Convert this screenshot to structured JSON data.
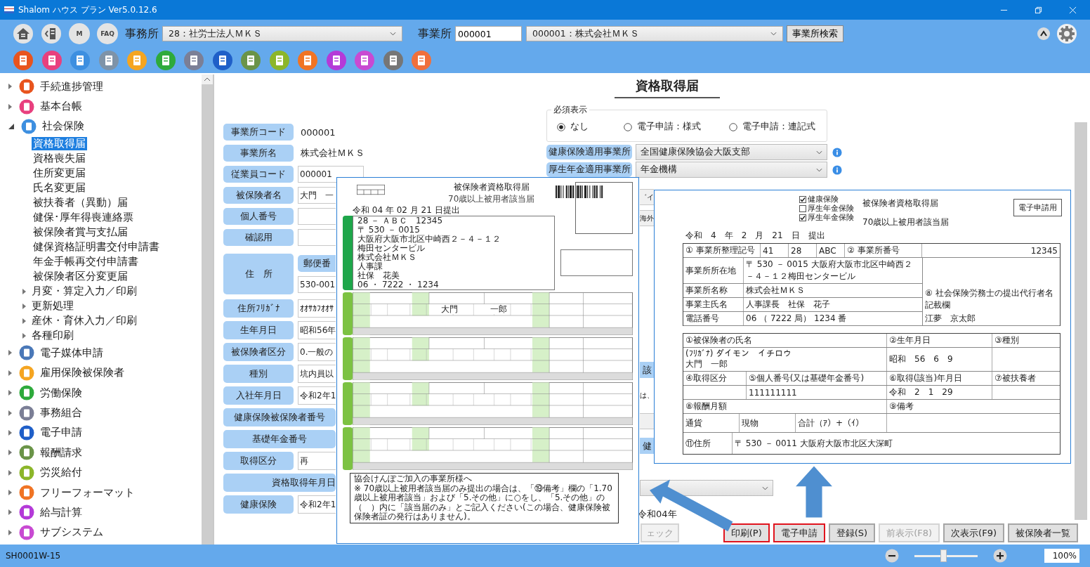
{
  "window": {
    "title": "Shalom ハウス プラン Ver5.0.12.6"
  },
  "toolbar": {
    "nav_buttons": [
      {
        "kind": "home"
      },
      {
        "kind": "back"
      },
      {
        "kind": "text",
        "text": "M"
      },
      {
        "kind": "text",
        "text": "FAQ"
      }
    ],
    "office_label": "事務所",
    "office_value": "28：社労士法人ＭＫＳ",
    "site_label": "事業所",
    "site_code": "000001",
    "site_value": "000001：株式会社ＭＫＳ",
    "search_button": "事業所検索",
    "app_icons": [
      {
        "color": "#e8541e"
      },
      {
        "color": "#e8407e"
      },
      {
        "color": "#3d8fe0"
      },
      {
        "color": "#7e93a8"
      },
      {
        "color": "#f5a521"
      },
      {
        "color": "#2eaa3c"
      },
      {
        "color": "#7b7f96"
      },
      {
        "color": "#1f5fc8"
      },
      {
        "color": "#6a9448"
      },
      {
        "color": "#8cb62a"
      },
      {
        "color": "#f07424"
      },
      {
        "color": "#b43ad8"
      },
      {
        "color": "#c84ad2"
      },
      {
        "color": "#767676"
      },
      {
        "color": "#f0703c"
      }
    ]
  },
  "sidebar": {
    "items": [
      {
        "label": "手続進捗管理",
        "color": "#e8541e",
        "expanded": false
      },
      {
        "label": "基本台帳",
        "color": "#e8407e",
        "expanded": false
      },
      {
        "label": "社会保険",
        "color": "#3d8fe0",
        "expanded": true,
        "children": [
          {
            "label": "資格取得届",
            "selected": true
          },
          {
            "label": "資格喪失届",
            "selected": false
          },
          {
            "label": "住所変更届",
            "selected": false
          },
          {
            "label": "氏名変更届",
            "selected": false
          },
          {
            "label": "被扶養者（異動）届",
            "selected": false
          },
          {
            "label": "健保･厚年得喪連絡票",
            "selected": false
          },
          {
            "label": "被保険者賞与支払届",
            "selected": false
          },
          {
            "label": "健保資格証明書交付申請書",
            "selected": false
          },
          {
            "label": "年金手帳再交付申請書",
            "selected": false
          },
          {
            "label": "被保険者区分変更届",
            "selected": false
          },
          {
            "label": "月変・算定入力／印刷",
            "expanded": false
          },
          {
            "label": "更新処理",
            "expanded": false
          },
          {
            "label": "産休・育休入力／印刷",
            "expanded": false
          },
          {
            "label": "各種印刷",
            "expanded": false
          }
        ]
      },
      {
        "label": "電子媒体申請",
        "color": "#4a78b8",
        "expanded": false
      },
      {
        "label": "雇用保険被保険者",
        "color": "#f5a521",
        "expanded": false
      },
      {
        "label": "労働保険",
        "color": "#2eaa3c",
        "expanded": false
      },
      {
        "label": "事務組合",
        "color": "#7b7f96",
        "expanded": false
      },
      {
        "label": "電子申請",
        "color": "#1f5fc8",
        "expanded": false
      },
      {
        "label": "報酬請求",
        "color": "#6a9448",
        "expanded": false
      },
      {
        "label": "労災給付",
        "color": "#8cb62a",
        "expanded": false
      },
      {
        "label": "フリーフォーマット",
        "color": "#f07424",
        "expanded": false
      },
      {
        "label": "給与計算",
        "color": "#b43ad8",
        "expanded": false
      },
      {
        "label": "サブシステム",
        "color": "#c84ad2",
        "expanded": false
      }
    ]
  },
  "form": {
    "title": "資格取得届",
    "left_rows": [
      {
        "kind": "text",
        "label": "事業所コード",
        "value": "000001"
      },
      {
        "kind": "text",
        "label": "事業所名",
        "value": "株式会社ＭＫＳ"
      },
      {
        "kind": "field",
        "label": "従業員コード",
        "value": "000001"
      },
      {
        "kind": "field",
        "label": "被保険者名",
        "value": "大門　一"
      },
      {
        "kind": "field",
        "label": "個人番号"
      },
      {
        "kind": "field",
        "label": "確認用"
      },
      {
        "kind": "address",
        "label": "住　所",
        "sub_label": "郵便番",
        "value": "530-001"
      },
      {
        "kind": "field",
        "label": "住所ﾌﾘｶﾞﾅ",
        "value": "ｵｵｻｶﾌｵｵｻ"
      },
      {
        "kind": "field",
        "label": "生年月日",
        "value": "昭和56年"
      },
      {
        "kind": "field",
        "label": "被保険者区分",
        "value": "0.一般の"
      },
      {
        "kind": "field",
        "label": "種別",
        "value": "坑内員以"
      },
      {
        "kind": "field",
        "label": "入社年月日",
        "value": "令和2年1"
      },
      {
        "kind": "wide",
        "label": "健康保険被保険者番号"
      },
      {
        "kind": "wide",
        "label": "基礎年金番号"
      },
      {
        "kind": "field",
        "label": "取得区分",
        "value": "再"
      },
      {
        "kind": "wide_right",
        "label": "資格取得年月日"
      },
      {
        "kind": "field",
        "label": "健康保険",
        "value": "令和2年1"
      }
    ],
    "required_group": {
      "legend": "必須表示",
      "options": [
        {
          "label": "なし",
          "selected": true
        },
        {
          "label": "電子申請：様式",
          "selected": false
        },
        {
          "label": "電子申請：連記式",
          "selected": false
        }
      ]
    },
    "right_rows": [
      {
        "kind": "select",
        "label": "健康保険適用事業所",
        "value": "全国健康保険協会大阪支部"
      },
      {
        "kind": "select",
        "label": "厚生年金適用事業所",
        "value": "年金機構"
      },
      {
        "kind": "field",
        "value": "゛イ"
      },
      {
        "kind": "field",
        "value": "海外"
      },
      {
        "kind": "label",
        "label": "該"
      },
      {
        "kind": "text",
        "value": "は、"
      },
      {
        "kind": "field"
      },
      {
        "kind": "label",
        "label": "健"
      },
      {
        "kind": "select"
      },
      {
        "kind": "text",
        "value": "令和04年"
      }
    ]
  },
  "footer": {
    "buttons": [
      {
        "label": "ェック",
        "disabled": true,
        "highlighted": false
      },
      {
        "label": "印刷(P)",
        "disabled": false,
        "highlighted": true
      },
      {
        "label": "電子申請",
        "disabled": false,
        "highlighted": true
      },
      {
        "label": "登録(S)",
        "disabled": false,
        "highlighted": false
      },
      {
        "label": "前表示(F8)",
        "disabled": true,
        "highlighted": false
      },
      {
        "label": "次表示(F9)",
        "disabled": false,
        "highlighted": false
      },
      {
        "label": "被保険者一覧",
        "disabled": false,
        "highlighted": false
      }
    ]
  },
  "print_preview": {
    "title": "被保険者資格取得届",
    "subtitle": "70歳以上被用者該当届",
    "date": "令和 04 年 02 月 21 日提出",
    "office_lines": [
      "28 － ＡＢＣ　12345",
      "〒 530 － 0015",
      "大阪府大阪市北区中崎西２－４－１２",
      "梅田センタービル",
      "株式会社ＭＫＳ",
      "人事課",
      "社保　花美",
      "06 ・ 7222 ・ 1234"
    ],
    "last_name": "大門",
    "first_name": "一郎",
    "notice_title": "協会けんぽご加入の事業所様へ",
    "notice_text": "※ 70歳以上被用者該当届のみ提出の場合は、「⑲備考」欄の「1.70歳以上被用者該当」および「5.その他」に○をし、「5.その他」の（　）内に「該当届のみ」とご記入ください(この場合、健康保険被保険者証の発行はありません)。"
  },
  "e_filing_preview": {
    "checks": [
      {
        "label": "健康保険",
        "checked": true
      },
      {
        "label": "厚生年金保険",
        "checked": false
      },
      {
        "label": "厚生年金保険",
        "checked": true
      }
    ],
    "title": "被保険者資格取得届",
    "subtitle": "70歳以上被用者該当届",
    "stamp": "電子申請用",
    "date": "令和　4　年　2　月　21　日　提出",
    "office": {
      "code_label": "① 事業所整理記号",
      "code_1": "41",
      "code_2": "28",
      "code_3": "ABC",
      "number_label": "② 事業所番号",
      "number": "12345",
      "address_label": "事業所所在地",
      "address": "〒 530 － 0015 大阪府大阪市北区中崎西２－４－１２梅田センタービル",
      "name_label": "事業所名称",
      "name": "株式会社ＭＫＳ",
      "owner_label": "事業主氏名",
      "owner": "人事課長　社保　花子",
      "phone_label": "電話番号",
      "phone": "06 （ 7222 局） 1234 番",
      "agent_label": "⑧ 社会保険労務士の提出代行者名記載欄",
      "agent": "江夢　京太郎"
    },
    "person": {
      "name_label": "①被保険者の氏名",
      "kana": "(ﾌﾘｶﾞﾅ) ダイモン　イチロウ",
      "name": "大門　一郎",
      "birth_label": "②生年月日",
      "birth": "昭和　56　6　9",
      "type_label": "③種別",
      "acq_label": "④取得区分",
      "number_label": "⑤個人番号(又は基礎年金番号)",
      "number": "111111111",
      "date_label": "⑥取得(該当)年月日",
      "date": "令和　2　1　29",
      "dependents_label": "⑦被扶養者",
      "pay_label": "⑧報酬月額",
      "pay_cash": "通貨",
      "pay_goods": "現物",
      "pay_total": "合計（ｱ）+（ｲ）",
      "note_label": "⑨備考",
      "address_label": "⑪住所",
      "address": "〒 530 － 0011 大阪府大阪市北区大深町"
    }
  },
  "status_bar": {
    "code": "SH0001W-15",
    "zoom": {
      "level": 0.45
    },
    "zoom_text": "100%"
  }
}
